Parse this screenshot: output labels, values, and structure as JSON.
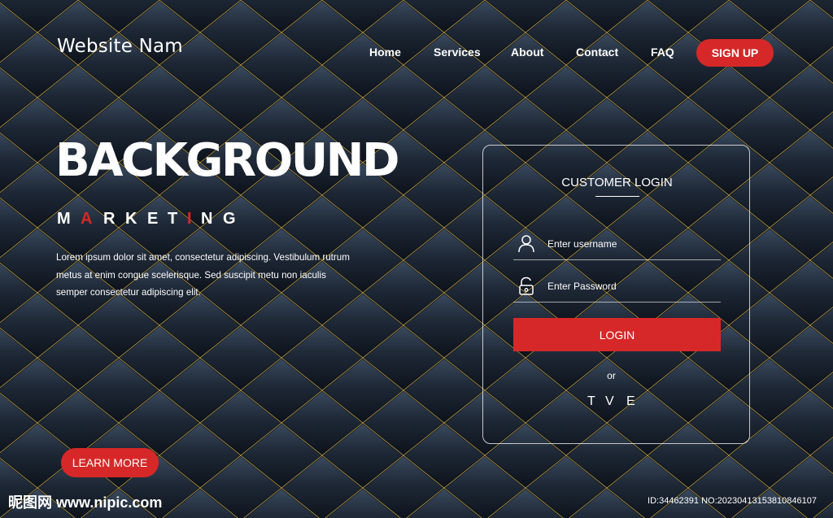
{
  "header": {
    "site_title": "Website Nam",
    "nav": [
      "Home",
      "Services",
      "About",
      "Contact",
      "FAQ"
    ],
    "signup_label": "SIGN UP"
  },
  "hero": {
    "title": "BACKGROUND",
    "subtitle_letters": [
      "M",
      "A",
      "R",
      "K",
      "E",
      "T",
      "I",
      "N",
      "G"
    ],
    "accent_letter_indexes": [
      1,
      6
    ],
    "body": "Lorem ipsum dolor sit amet, consectetur adipiscing. Vestibulum rutrum metus at enim congue scelerisque. Sed suscipit metu non iaculis semper consectetur adipiscing elit.",
    "cta_label": "LEARN MORE"
  },
  "login": {
    "title": "CUSTOMER LOGIN",
    "username_placeholder": "Enter username",
    "password_placeholder": "Enter Password",
    "button_label": "LOGIN",
    "or_label": "or",
    "social": [
      "T",
      "V",
      "E"
    ]
  },
  "watermark": {
    "logo_text": "昵图网 www.nipic.com",
    "id_text": "ID:34462391 NO:20230413153810846107"
  },
  "colors": {
    "accent": "#d62828",
    "background": "#1a2230",
    "gold_line": "#c9a94a"
  },
  "icons": {
    "username": "user-icon",
    "password": "lock-icon"
  }
}
